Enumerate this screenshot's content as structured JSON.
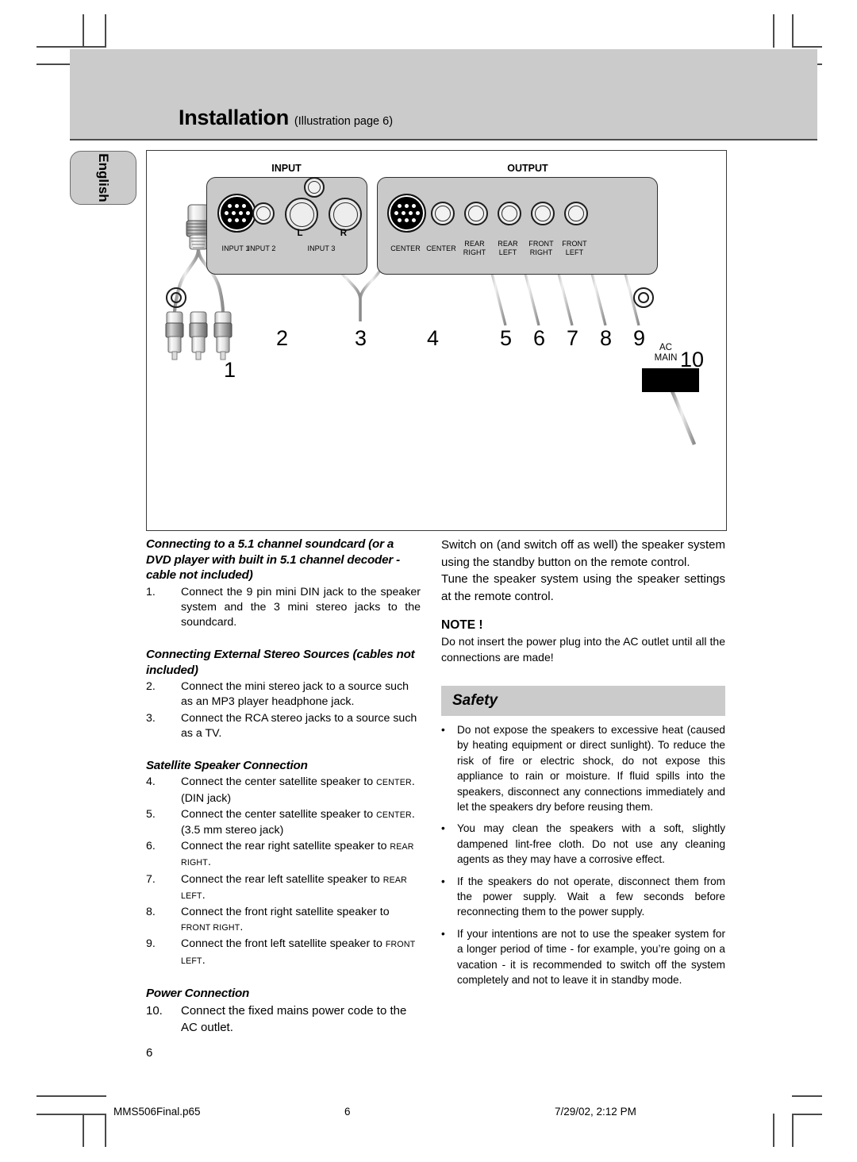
{
  "header": {
    "title": "Installation",
    "subtitle": "(Illustration page 6)",
    "language_tab": "English",
    "band_color": "#cbcbcb"
  },
  "illustration": {
    "input_title": "INPUT",
    "output_title": "OUTPUT",
    "input_jacks": [
      {
        "label": "INPUT 1",
        "type": "din"
      },
      {
        "label": "INPUT 2",
        "type": "minijack"
      },
      {
        "label": "INPUT 3",
        "type": "rca-pair",
        "left": "L",
        "right": "R"
      }
    ],
    "output_jacks": [
      {
        "label": "CENTER",
        "type": "din"
      },
      {
        "label": "CENTER",
        "type": "minijack"
      },
      {
        "label": "REAR RIGHT",
        "line1": "REAR",
        "line2": "RIGHT",
        "type": "minijack"
      },
      {
        "label": "REAR LEFT",
        "line1": "REAR",
        "line2": "LEFT",
        "type": "minijack"
      },
      {
        "label": "FRONT RIGHT",
        "line1": "FRONT",
        "line2": "RIGHT",
        "type": "minijack"
      },
      {
        "label": "FRONT LEFT",
        "line1": "FRONT",
        "line2": "LEFT",
        "type": "minijack"
      }
    ],
    "ac_label_line1": "AC",
    "ac_label_line2": "MAIN",
    "callouts": [
      "1",
      "2",
      "3",
      "4",
      "5",
      "6",
      "7",
      "8",
      "9",
      "10"
    ]
  },
  "left_column": {
    "heading1": "Connecting to a 5.1 channel soundcard (or a DVD player with built in 5.1 channel decoder - cable not included)",
    "item1_num": "1.",
    "item1_text": "Connect the 9 pin mini DIN jack to the speaker system and the 3 mini stereo jacks to the soundcard.",
    "heading2": "Connecting External Stereo Sources (cables not included)",
    "item2_num": "2.",
    "item2_text": "Connect the mini stereo jack to a source such as an MP3 player headphone jack.",
    "item3_num": "3.",
    "item3_text": "Connect the RCA stereo jacks to a source such as a TV.",
    "heading3": "Satellite Speaker Connection",
    "item4_num": "4.",
    "item4_text": "Connect the center satellite speaker to ",
    "item4_sc": "CENTER",
    "item4_tail": ". (DIN jack)",
    "item5_num": "5.",
    "item5_text": "Connect the center satellite speaker to ",
    "item5_sc": "CENTER",
    "item5_tail": ". (3.5 mm stereo jack)",
    "item6_num": "6.",
    "item6_text": "Connect the rear right satellite speaker to ",
    "item6_sc": "REAR RIGHT",
    "item6_tail": ".",
    "item7_num": "7.",
    "item7_text": "Connect the rear left satellite speaker to ",
    "item7_sc": "REAR LEFT",
    "item7_tail": ".",
    "item8_num": "8.",
    "item8_text": "Connect the front right satellite speaker to ",
    "item8_sc": "FRONT RIGHT",
    "item8_tail": ".",
    "item9_num": "9.",
    "item9_text": "Connect the front left satellite speaker to ",
    "item9_sc": "FRONT LEFT",
    "item9_tail": ".",
    "heading4": "Power Connection",
    "item10_num": "10.",
    "item10_text": "Connect the fixed mains power code to the AC outlet."
  },
  "right_column": {
    "para1": "Switch on (and switch off as well) the speaker system using the standby button on the remote control.",
    "para2": "Tune the speaker system using the speaker settings at the remote control.",
    "note_heading": "NOTE !",
    "note_body": "Do not insert the power plug into the AC outlet until all the connections are made!",
    "safety_title": "Safety",
    "bullet_char": "•",
    "bullets": [
      "Do not expose the speakers to excessive heat (caused by heating equipment or direct sunlight). To reduce the risk of fire or electric shock, do not expose this appliance to rain or moisture. If fluid spills into the speakers, disconnect any connections immediately and let the speakers dry before reusing them.",
      "You may clean the speakers with a soft, slightly dampened lint-free cloth. Do not use any cleaning agents as they may have a corrosive effect.",
      "If the speakers do not operate, disconnect them from the power supply. Wait a few seconds before reconnecting them to the power supply.",
      "If your intentions are not to use the speaker system for a longer period of time - for example, you’re going on a vacation - it is recommended to switch off the system completely and not to leave it in standby mode."
    ]
  },
  "page_number": "6",
  "footer": {
    "filename": "MMS506Final.p65",
    "page": "6",
    "timestamp": "7/29/02, 2:12 PM"
  }
}
